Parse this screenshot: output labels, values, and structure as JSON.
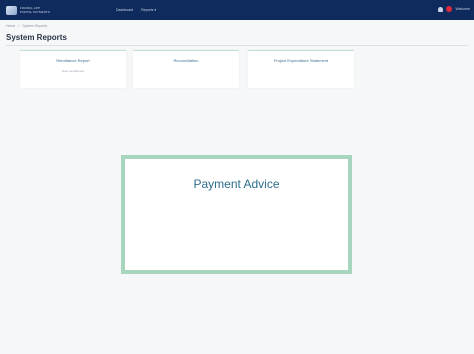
{
  "header": {
    "logo_line1": "FORMAL APP",
    "logo_line2": "PORTAL PAYMENTS",
    "nav": [
      {
        "label": "Dashboard"
      },
      {
        "label": "Reports ▾"
      }
    ],
    "user": "Welcome"
  },
  "breadcrumb": {
    "items": [
      "Home",
      "/",
      "System Reports"
    ]
  },
  "page": {
    "title": "System Reports"
  },
  "cards": [
    {
      "title": "Remittance Report",
      "subtitle": "View remittances"
    },
    {
      "title": "Reconciliation",
      "subtitle": ""
    },
    {
      "title": "Project Expenditure Statement",
      "subtitle": ""
    }
  ],
  "highlight": {
    "title": "Payment Advice"
  },
  "colors": {
    "navbar": "#0f2a5c",
    "accent_border": "#a8d5be",
    "title_text": "#2b6d8c",
    "alert": "#e0293a"
  }
}
